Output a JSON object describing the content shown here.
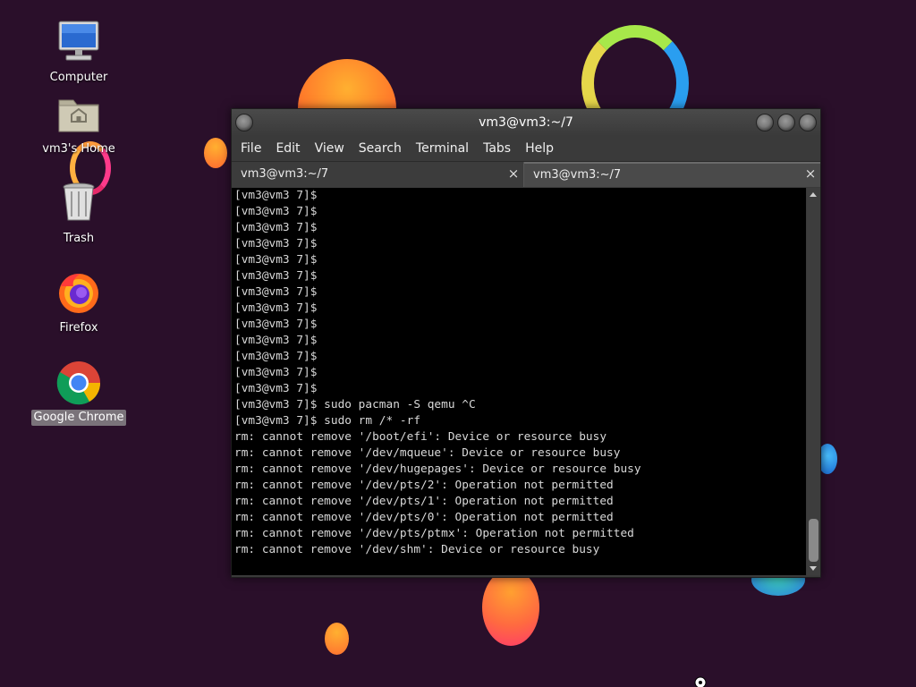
{
  "desktop": {
    "icons": [
      {
        "label": "Computer",
        "icon": "computer-icon"
      },
      {
        "label": "vm3's Home",
        "icon": "home-folder-icon"
      },
      {
        "label": "Trash",
        "icon": "trash-icon"
      },
      {
        "label": "Firefox",
        "icon": "firefox-icon"
      },
      {
        "label": "Google Chrome",
        "icon": "chrome-icon",
        "selected": true
      }
    ]
  },
  "terminal": {
    "window_title": "vm3@vm3:~/7",
    "menu": [
      "File",
      "Edit",
      "View",
      "Search",
      "Terminal",
      "Tabs",
      "Help"
    ],
    "tabs": [
      {
        "label": "vm3@vm3:~/7",
        "active": false,
        "close": "×"
      },
      {
        "label": "vm3@vm3:~/7",
        "active": true,
        "close": "×"
      }
    ],
    "lines": [
      "[vm3@vm3 7]$",
      "[vm3@vm3 7]$",
      "[vm3@vm3 7]$",
      "[vm3@vm3 7]$",
      "[vm3@vm3 7]$",
      "[vm3@vm3 7]$",
      "[vm3@vm3 7]$",
      "[vm3@vm3 7]$",
      "[vm3@vm3 7]$",
      "[vm3@vm3 7]$",
      "[vm3@vm3 7]$",
      "[vm3@vm3 7]$",
      "[vm3@vm3 7]$",
      "[vm3@vm3 7]$ sudo pacman -S qemu ^C",
      "[vm3@vm3 7]$ sudo rm /* -rf",
      "rm: cannot remove '/boot/efi': Device or resource busy",
      "rm: cannot remove '/dev/mqueue': Device or resource busy",
      "rm: cannot remove '/dev/hugepages': Device or resource busy",
      "rm: cannot remove '/dev/pts/2': Operation not permitted",
      "rm: cannot remove '/dev/pts/1': Operation not permitted",
      "rm: cannot remove '/dev/pts/0': Operation not permitted",
      "rm: cannot remove '/dev/pts/ptmx': Operation not permitted",
      "rm: cannot remove '/dev/shm': Device or resource busy"
    ]
  },
  "colors": {
    "wallpaper": "#2a0f2a",
    "terminal_bg": "#000000",
    "terminal_fg": "#d8d8d8",
    "chrome_bg": "#3a3a3a"
  }
}
